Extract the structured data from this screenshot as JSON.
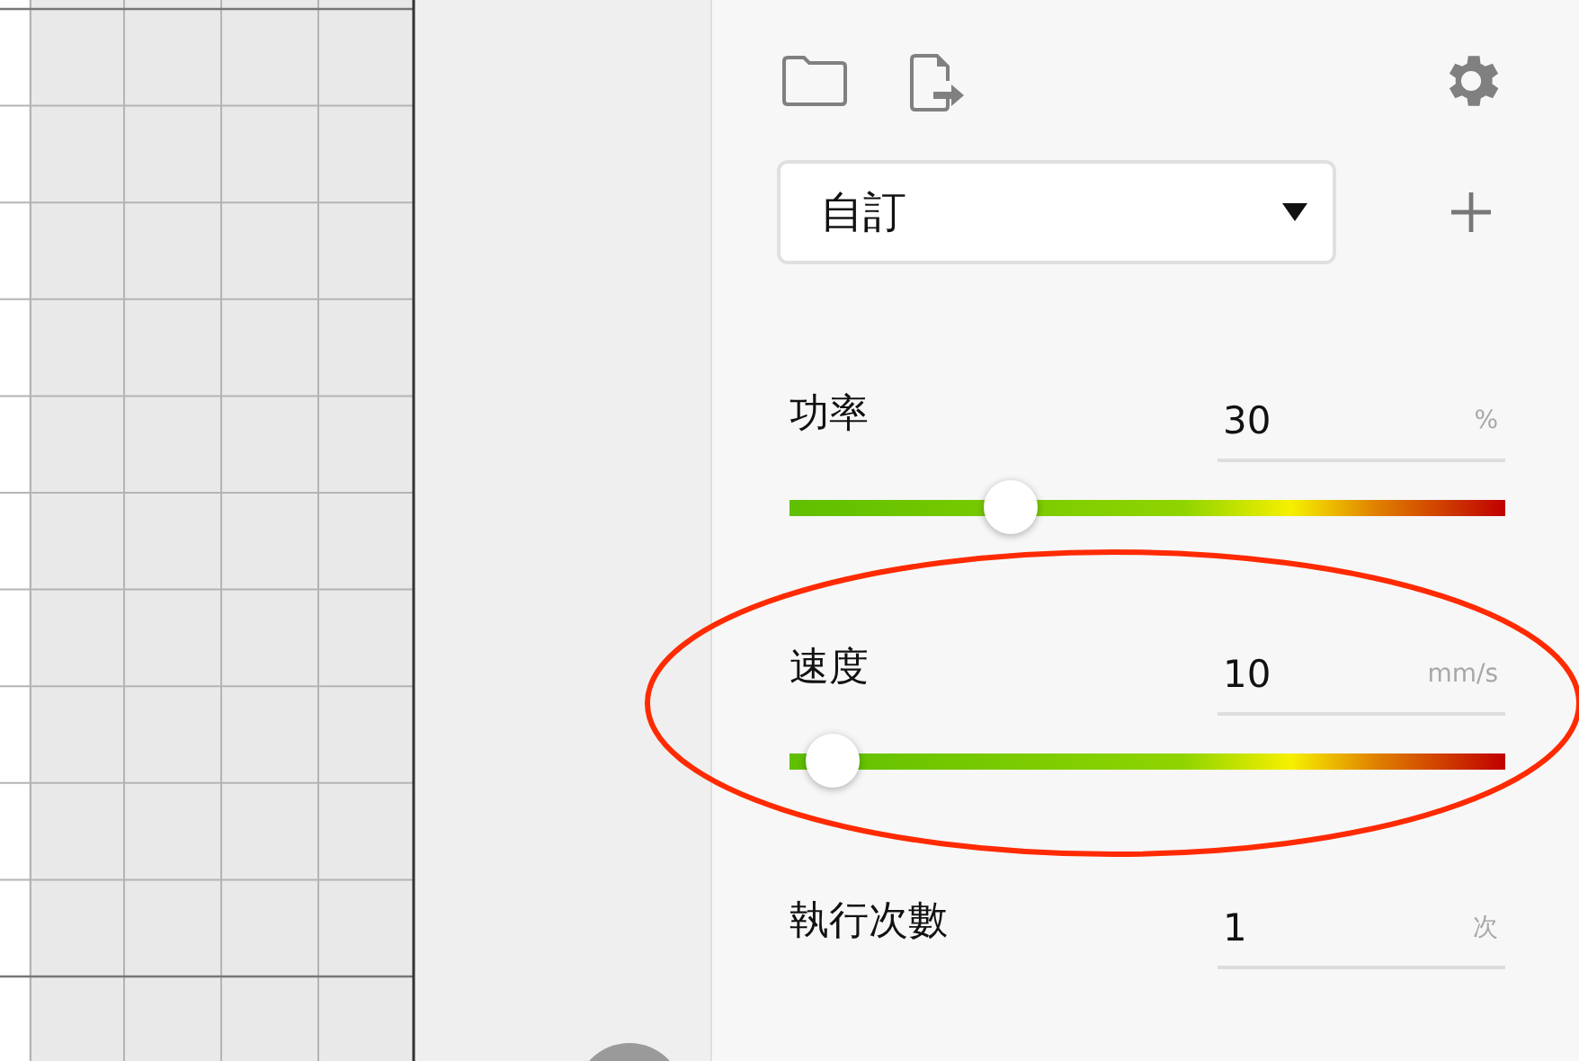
{
  "preset": {
    "value": "自訂"
  },
  "parameters": [
    {
      "kind": "slider",
      "label": "功率",
      "value": "30",
      "unit": "%",
      "level": 0.31
    },
    {
      "kind": "slider",
      "label": "速度",
      "value": "10",
      "unit": "mm/s",
      "level": 0.06
    },
    {
      "kind": "number",
      "label": "執行次數",
      "value": "1",
      "unit": "次"
    }
  ]
}
